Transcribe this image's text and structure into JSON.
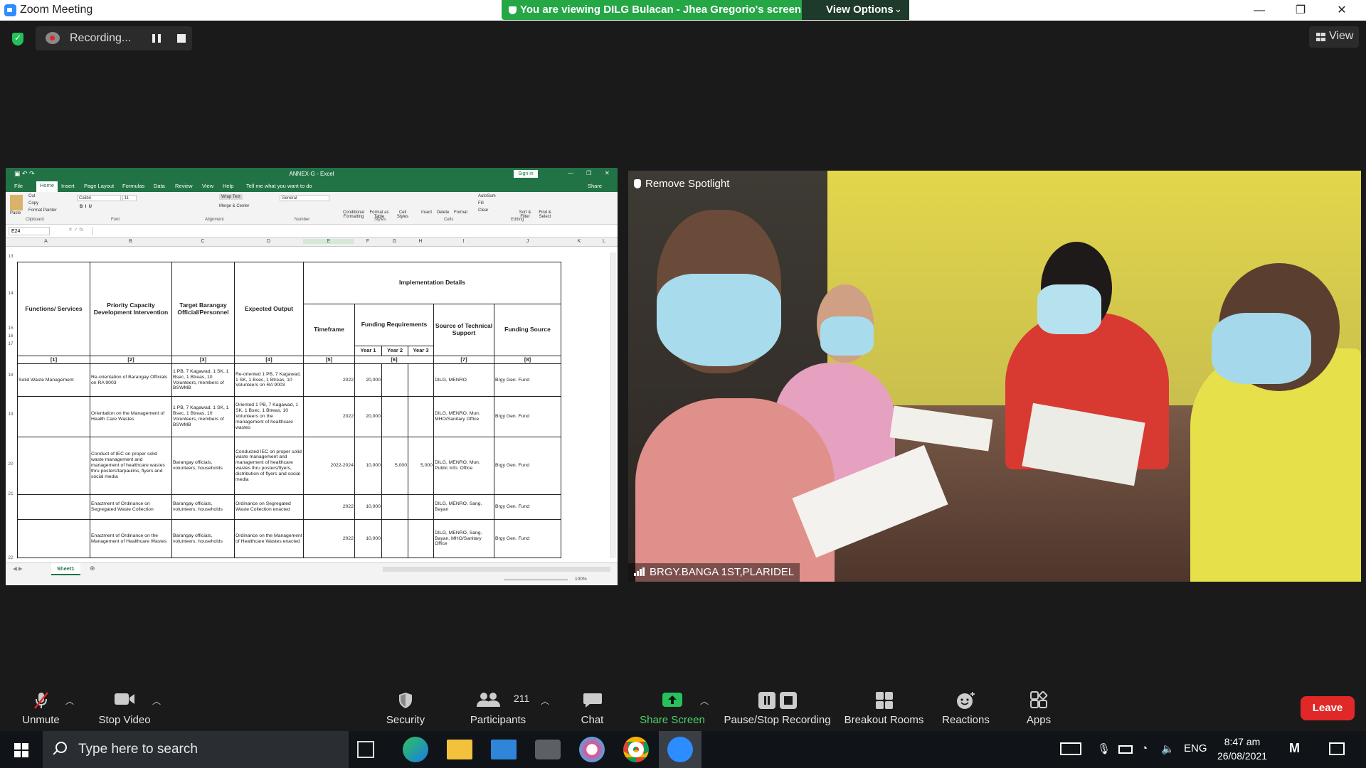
{
  "window": {
    "title": "Zoom Meeting",
    "share_banner": "You are viewing DILG Bulacan - Jhea Gregorio's screen",
    "view_options": "View Options",
    "minimize": "—",
    "restore": "❐",
    "close": "✕"
  },
  "topbar": {
    "recording_text": "Recording...",
    "view_label": "View"
  },
  "excel": {
    "title": "ANNEX-G  -  Excel",
    "signin": "Sign in",
    "tabs": [
      "File",
      "Home",
      "Insert",
      "Page Layout",
      "Formulas",
      "Data",
      "Review",
      "View",
      "Help",
      "Tell me what you want to do"
    ],
    "share": "Share",
    "ribbon": {
      "cut": "Cut",
      "copy": "Copy",
      "format_painter": "Format Painter",
      "paste": "Paste",
      "font": "Calibri",
      "size": "11",
      "wrap_text": "Wrap Text",
      "merge_center": "Merge & Center",
      "number_format": "General",
      "conditional": "Conditional Formatting",
      "format_table": "Format as Table",
      "cell_styles": "Cell Styles",
      "insert": "Insert",
      "delete": "Delete",
      "format": "Format",
      "autosum": "AutoSum",
      "fill": "Fill",
      "clear": "Clear",
      "sort_filter": "Sort & Filter",
      "find_select": "Find & Select",
      "groups": [
        "Clipboard",
        "Font",
        "Alignment",
        "Number",
        "Styles",
        "Cells",
        "Editing"
      ]
    },
    "name_box": "E24",
    "columns": [
      "A",
      "B",
      "C",
      "D",
      "E",
      "F",
      "G",
      "H",
      "I",
      "J",
      "K",
      "L"
    ],
    "row_numbers": [
      "13",
      "14",
      "15",
      "16",
      "17",
      "18",
      "19",
      "20",
      "21",
      "22"
    ],
    "headers": {
      "functions": "Functions/ Services",
      "priority": "Priority Capacity Development Intervention",
      "target": "Target Barangay Official/Personnel",
      "expected": "Expected Output",
      "implementation": "Implementation Details",
      "timeframe": "Timeframe",
      "funding_req": "Funding Requirements",
      "technical": "Source of Technical Support",
      "funding_source": "Funding Source",
      "year1": "Year 1",
      "year2": "Year 2",
      "year3": "Year 3",
      "idx": [
        "[1]",
        "[2]",
        "[3]",
        "[4]",
        "[5]",
        "[6]",
        "[7]",
        "[8]"
      ]
    },
    "rows": [
      {
        "func": "Solid Waste Management",
        "priority": "Re-orientation of Barangay Officials on RA 9003",
        "target": "1 PB, 7 Kagawad, 1 SK, 1 Bsec, 1 Btreas, 10 Volunteers, members of BSWMB",
        "output": "Re-oriented 1 PB, 7 Kagawad, 1 SK, 1 Bsec, 1 Btreas, 10 Volunteers on RA 9003",
        "time": "2022",
        "y1": "20,000",
        "y2": "",
        "y3": "",
        "tech": "DILG, MENRO",
        "fund": "Brgy Gen. Fund"
      },
      {
        "func": "",
        "priority": "Orientation on the Management of Health Care Wastes",
        "target": "1 PB, 7 Kagawad, 1 SK, 1 Bsec, 1 Btreas, 10 Volunteers, members of BSWMB",
        "output": "Oriented 1 PB, 7 Kagawad, 1 SK, 1 Bsec, 1 Btreas, 10 Volunteers on the management of healthcare wastes",
        "time": "2022",
        "y1": "20,000",
        "y2": "",
        "y3": "",
        "tech": "DILG, MENRO, Mun. MHO/Sanitary Office",
        "fund": "Brgy Gen. Fund"
      },
      {
        "func": "",
        "priority": "Conduct of IEC on proper solid waste management and management of healthcare wastes thru posters/tarpaulins, flyers and social media",
        "target": "Barangay officials, volunteers, households",
        "output": "Conducted IEC on proper solid waste management and management of healthcare wastes thru posters/flyers, distribution of flyers and social media",
        "time": "2022-2024",
        "y1": "10,000",
        "y2": "5,000",
        "y3": "5,000",
        "tech": "DILG, MENRO, Mun. Public Info. Office",
        "fund": "Brgy Gen. Fund"
      },
      {
        "func": "",
        "priority": "Enactment of Ordinance on Segregated Waste Collection",
        "target": "Barangay officials, volunteers, households",
        "output": "Ordinance on Segregated Waste Collection enacted",
        "time": "2022",
        "y1": "10,000",
        "y2": "",
        "y3": "",
        "tech": "DILG, MENRO, Sang. Bayan",
        "fund": "Brgy Gen. Fund"
      },
      {
        "func": "",
        "priority": "Enactment of Ordinance on the Management of Healthcare Wastes",
        "target": "Barangay officials, volunteers, households",
        "output": "Ordinance on the Management of Healthcare Wastes enacted",
        "time": "2022",
        "y1": "10,000",
        "y2": "",
        "y3": "",
        "tech": "DILG, MENRO, Sang. Bayan, MHO/Sanitary Office",
        "fund": "Brgy Gen. Fund"
      }
    ],
    "sheet_tab": "Sheet1",
    "zoom": "100%"
  },
  "video": {
    "remove_spotlight": "Remove Spotlight",
    "participant_name": "BRGY.BANGA 1ST,PLARIDEL"
  },
  "toolbar": {
    "unmute": "Unmute",
    "stop_video": "Stop Video",
    "security": "Security",
    "participants": "Participants",
    "participant_count": "211",
    "chat": "Chat",
    "share_screen": "Share Screen",
    "pause_stop_recording": "Pause/Stop Recording",
    "breakout_rooms": "Breakout Rooms",
    "reactions": "Reactions",
    "apps": "Apps",
    "leave": "Leave"
  },
  "taskbar": {
    "search_placeholder": "Type here to search",
    "language": "ENG",
    "time": "8:47 am",
    "date": "26/08/2021"
  },
  "colors": {
    "zoom_blue": "#2d8cff",
    "share_green": "#26a746",
    "leave_red": "#e02828",
    "excel_green": "#217346"
  }
}
